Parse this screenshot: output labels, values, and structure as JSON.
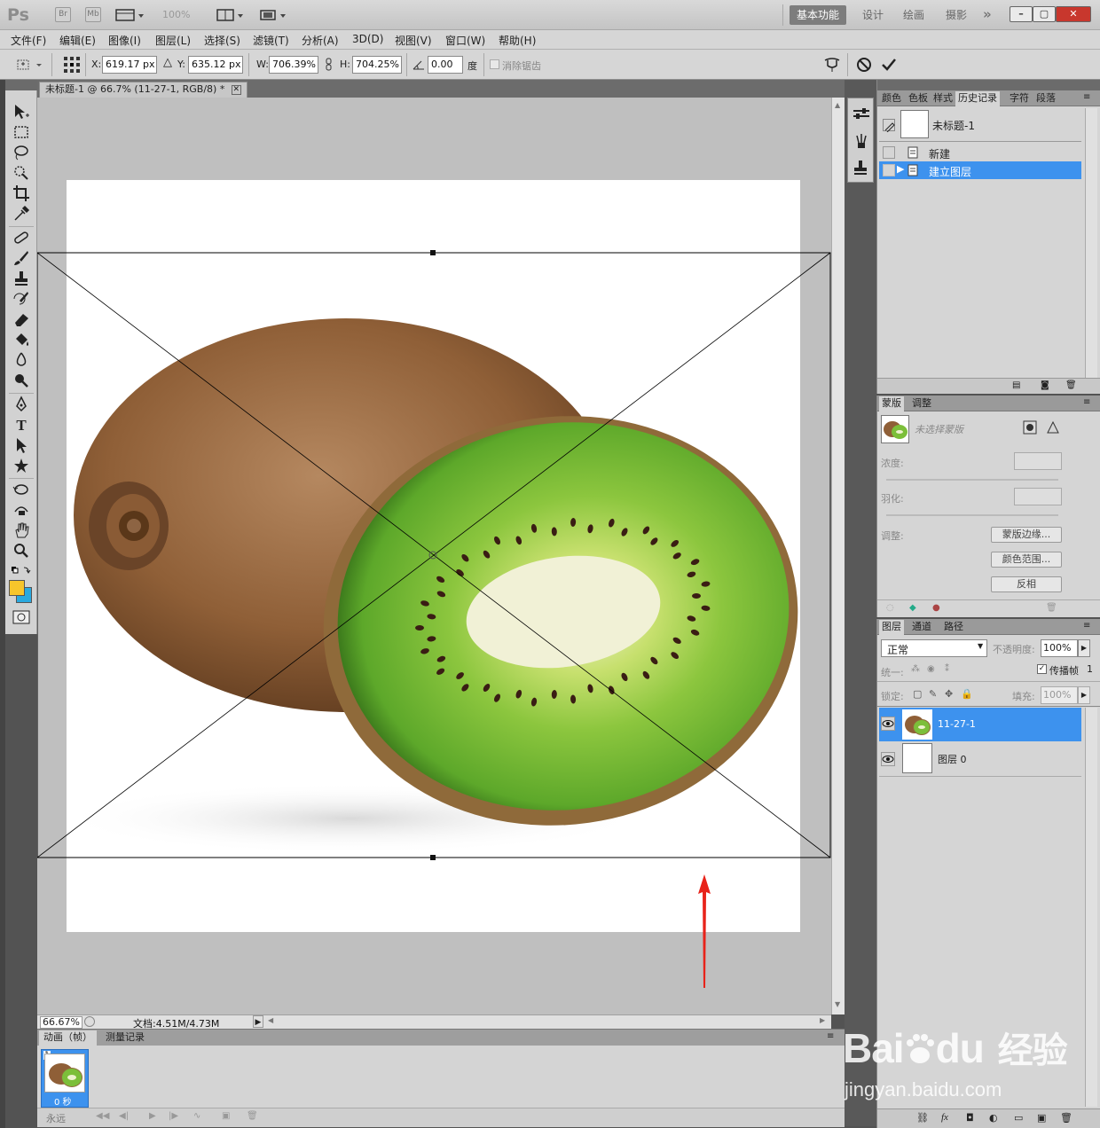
{
  "titlebar": {
    "logo": "Ps",
    "bridge": "Br",
    "minibridge": "Mb",
    "zoom": "100%",
    "workspaces": [
      "基本功能",
      "设计",
      "绘画",
      "摄影"
    ],
    "more": "»",
    "win": {
      "min": "–",
      "max": "▢",
      "close": "✕"
    }
  },
  "menu": [
    "文件(F)",
    "编辑(E)",
    "图像(I)",
    "图层(L)",
    "选择(S)",
    "滤镜(T)",
    "分析(A)",
    "3D(D)",
    "视图(V)",
    "窗口(W)",
    "帮助(H)"
  ],
  "options": {
    "x_label": "X:",
    "x_value": "619.17 px",
    "y_label": "Y:",
    "y_value": "635.12 px",
    "w_label": "W:",
    "w_value": "706.39%",
    "h_label": "H:",
    "h_value": "704.25%",
    "angle_value": "0.00",
    "angle_unit": "度",
    "antialias_label": "消除锯齿"
  },
  "document": {
    "tab_title": "未标题-1 @ 66.7% (11-27-1, RGB/8) *",
    "zoom": "66.67%",
    "doc_info": "文档:4.51M/4.73M"
  },
  "animation": {
    "tabs": [
      "动画（帧）",
      "测量记录"
    ],
    "frame_number": "1",
    "frame_delay": "0 秒",
    "loop": "永远"
  },
  "history": {
    "tabs": [
      "颜色",
      "色板",
      "样式",
      "历史记录",
      "字符",
      "段落"
    ],
    "snapshot": "未标题-1",
    "items": [
      "新建",
      "建立图层"
    ]
  },
  "masks": {
    "tabs": [
      "蒙版",
      "调整"
    ],
    "no_mask": "未选择蒙版",
    "density": "浓度:",
    "feather": "羽化:",
    "refine": "调整:",
    "btn_edge": "蒙版边缘...",
    "btn_color": "颜色范围...",
    "btn_invert": "反相"
  },
  "layers": {
    "tabs": [
      "图层",
      "通道",
      "路径"
    ],
    "blend_mode": "正常",
    "opacity_label": "不透明度:",
    "opacity": "100%",
    "unify_label": "统一:",
    "propagate_label": "传播帧",
    "propagate_num": "1",
    "lock_label": "锁定:",
    "fill_label": "填充:",
    "fill": "100%",
    "items": [
      "11-27-1",
      "图层 0"
    ]
  },
  "colors": {
    "foreground": "#f7c52b",
    "background": "#2aa9df",
    "selection": "#3d92ee",
    "arrow": "#e8231a"
  },
  "watermark": {
    "brand": "Bai",
    "brand2": "du",
    "cn": "经验",
    "url": "jingyan.baidu.com"
  }
}
